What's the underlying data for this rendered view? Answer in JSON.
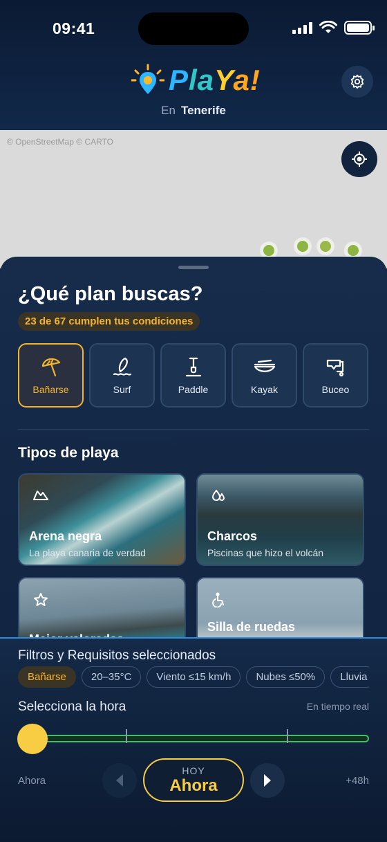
{
  "status": {
    "time": "09:41"
  },
  "header": {
    "logo_text": "PlaYa!",
    "location_prefix": "En",
    "location_city": "Tenerife"
  },
  "map": {
    "attribution": "© OpenStreetMap  © CARTO"
  },
  "sheet": {
    "title": "¿Qué plan buscas?",
    "count_badge": "23 de 67 cumplen tus condiciones",
    "activities": [
      {
        "label": "Bañarse",
        "icon": "umbrella-icon",
        "active": true
      },
      {
        "label": "Surf",
        "icon": "surfboard-icon",
        "active": false
      },
      {
        "label": "Paddle",
        "icon": "paddle-icon",
        "active": false
      },
      {
        "label": "Kayak",
        "icon": "kayak-icon",
        "active": false
      },
      {
        "label": "Buceo",
        "icon": "snorkel-icon",
        "active": false
      }
    ],
    "section_title": "Tipos de playa",
    "beach_types": [
      {
        "title": "Arena negra",
        "subtitle": "La playa canaria de verdad",
        "icon": "mountain-icon"
      },
      {
        "title": "Charcos",
        "subtitle": "Piscinas que hizo el volcán",
        "icon": "droplets-icon"
      },
      {
        "title": "Mejor valoradas",
        "subtitle": "",
        "icon": "star-icon"
      },
      {
        "title": "Silla de ruedas",
        "subtitle": "",
        "icon": "wheelchair-icon"
      }
    ]
  },
  "filters": {
    "title": "Filtros y Requisitos seleccionados",
    "chips": [
      "Bañarse",
      "20–35°C",
      "Viento ≤15 km/h",
      "Nubes ≤50%",
      "Lluvia"
    ]
  },
  "time": {
    "label": "Selecciona la hora",
    "realtime": "En tiempo real",
    "start": "Ahora",
    "end": "+48h",
    "day": "HOY",
    "value": "Ahora",
    "position": 0
  },
  "colors": {
    "accent": "#f5b52a",
    "slider": "#3fbf6a",
    "background": "#0d1c33"
  }
}
